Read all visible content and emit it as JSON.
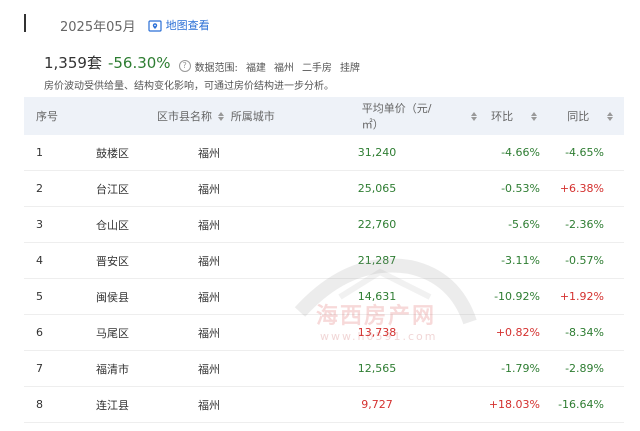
{
  "header": {
    "period": "2025年05月",
    "map_link_label": "地图查看"
  },
  "summary": {
    "total": "1,359套",
    "change": "-56.30%",
    "change_color": "#2e7d32",
    "scope_label": "数据范围:",
    "scope_tags": [
      "福建",
      "福州",
      "二手房",
      "挂牌"
    ]
  },
  "note": "房价波动受供给量、结构变化影响，可通过房价结构进一步分析。",
  "table": {
    "headers": {
      "no": "序号",
      "name": "区市县名称",
      "city": "所属城市",
      "price": "平均单价（元/㎡）",
      "hb": "环比",
      "tb": "同比"
    },
    "rows": [
      {
        "no": "1",
        "name": "鼓楼区",
        "city": "福州",
        "price": "31,240",
        "hb": "-4.66%",
        "tb": "-4.65%"
      },
      {
        "no": "2",
        "name": "台江区",
        "city": "福州",
        "price": "25,065",
        "hb": "-0.53%",
        "tb": "+6.38%"
      },
      {
        "no": "3",
        "name": "仓山区",
        "city": "福州",
        "price": "22,760",
        "hb": "-5.6%",
        "tb": "-2.36%"
      },
      {
        "no": "4",
        "name": "晋安区",
        "city": "福州",
        "price": "21,287",
        "hb": "-3.11%",
        "tb": "-0.57%"
      },
      {
        "no": "5",
        "name": "闽侯县",
        "city": "福州",
        "price": "14,631",
        "hb": "-10.92%",
        "tb": "+1.92%"
      },
      {
        "no": "6",
        "name": "马尾区",
        "city": "福州",
        "price": "13,738",
        "hb": "+0.82%",
        "tb": "-8.34%"
      },
      {
        "no": "7",
        "name": "福清市",
        "city": "福州",
        "price": "12,565",
        "hb": "-1.79%",
        "tb": "-2.89%"
      },
      {
        "no": "8",
        "name": "连江县",
        "city": "福州",
        "price": "9,727",
        "hb": "+18.03%",
        "tb": "-16.64%"
      }
    ]
  },
  "watermark": {
    "text": "海西房产网",
    "url": "www.h0591.com"
  },
  "colors": {
    "accent": "#2a6fd6",
    "positive": "#d4312f",
    "negative": "#2e7d32",
    "header_bg": "#eef2f8"
  }
}
